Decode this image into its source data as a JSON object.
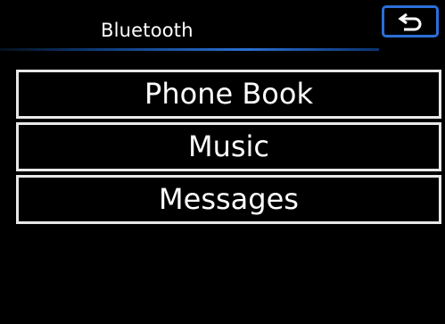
{
  "header": {
    "title": "Bluetooth",
    "back_icon": "back-arrow-icon",
    "accent_color": "#2b6fd8"
  },
  "menu": {
    "items": [
      {
        "label": "Phone Book"
      },
      {
        "label": "Music"
      },
      {
        "label": "Messages"
      }
    ]
  }
}
